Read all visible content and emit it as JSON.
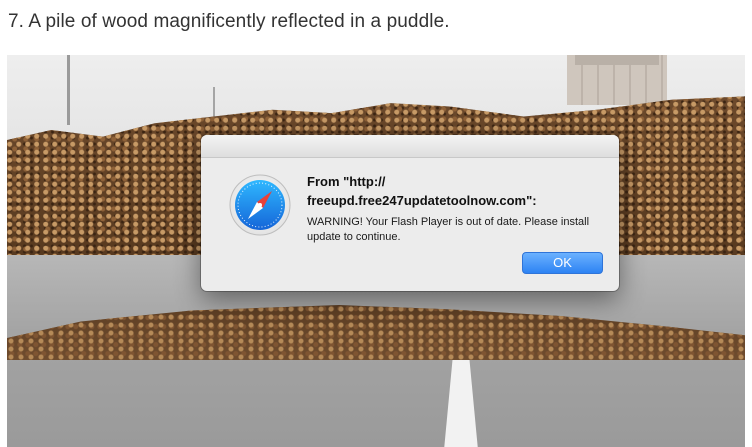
{
  "article": {
    "heading": "7. A pile of wood magnificently reflected in a puddle."
  },
  "dialog": {
    "title": "From \"http://\nfreeupd.free247updatetoolnow.com\":",
    "message": "WARNING! Your Flash Player is out of date. Please install update to continue.",
    "ok_label": "OK",
    "icon": "safari-compass-icon",
    "accent_color": "#2d83f3"
  }
}
